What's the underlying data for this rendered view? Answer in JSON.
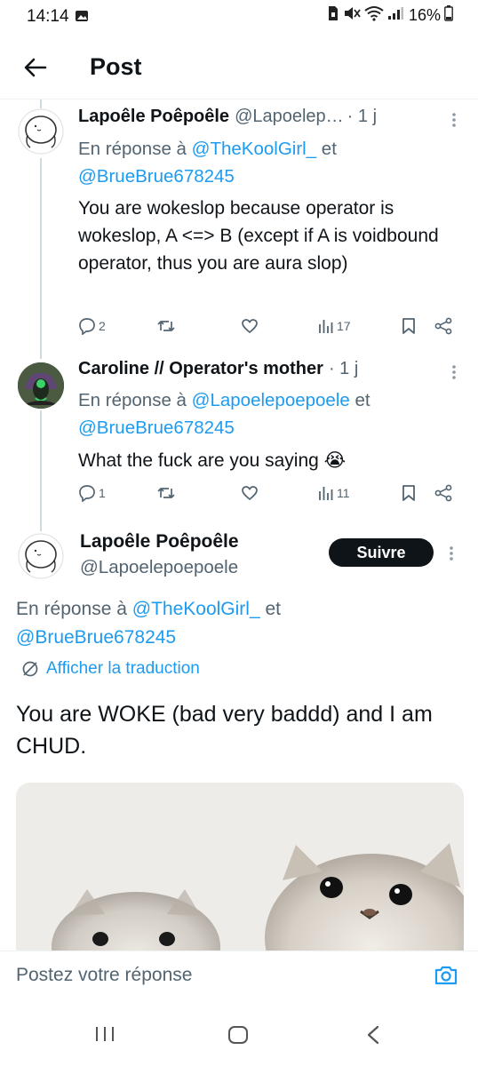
{
  "status_bar": {
    "time": "14:14",
    "battery": "16%"
  },
  "header": {
    "title": "Post"
  },
  "replies": [
    {
      "name": "Lapoêle Poêpoêle",
      "handle": "@Lapoelep…",
      "time": "· 1 j",
      "reply_prefix": "En réponse à ",
      "mention_1": "@TheKoolGirl_",
      "reply_joiner": " et ",
      "mention_2": "@BrueBrue678245",
      "text": "You are wokeslop because operator is wokeslop, A <=> B (except if A is voidbound operator, thus you are aura slop)",
      "replies": "2",
      "views": "17"
    },
    {
      "name": "Caroline // Operator's mother",
      "handle": "",
      "time": "· 1 j",
      "reply_prefix": "En réponse à ",
      "mention_1": "@Lapoelepoepoele",
      "reply_joiner": " et ",
      "mention_2": "@BrueBrue678245",
      "text": "What the fuck are you saying 😭",
      "replies": "1",
      "views": "11"
    }
  ],
  "main_post": {
    "name": "Lapoêle Poêpoêle",
    "handle": "@Lapoelepoepoele",
    "follow_label": "Suivre",
    "reply_prefix": "En réponse à ",
    "mention_1": "@TheKoolGirl_",
    "reply_joiner": " et",
    "mention_2": "@BrueBrue678245",
    "translate_label": "Afficher la traduction",
    "text": "You are WOKE (bad very baddd) and I am CHUD."
  },
  "reply_bar": {
    "placeholder": "Postez votre réponse"
  },
  "colors": {
    "accent": "#1d9bf0",
    "text": "#0f1419",
    "muted": "#536471",
    "thread_line": "#cfd9de"
  },
  "icons": [
    "back-arrow-icon",
    "reply-icon",
    "repost-icon",
    "like-icon",
    "views-icon",
    "bookmark-icon",
    "share-icon",
    "translate-icon",
    "camera-icon"
  ]
}
